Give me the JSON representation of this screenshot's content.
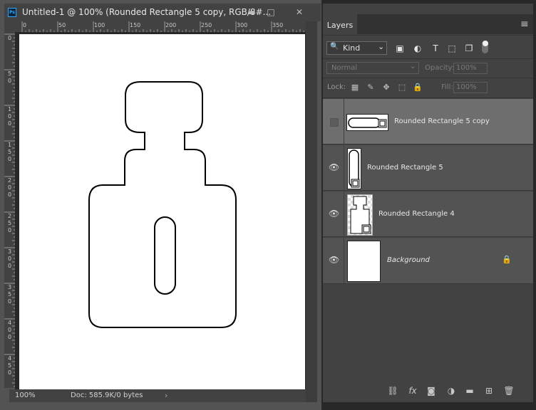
{
  "document": {
    "app_icon": "Ps",
    "title": "Untitled-1 @ 100% (Rounded Rectangle 5 copy, RGB/8#...",
    "window_buttons": {
      "minimize": "▬",
      "maximize": "□",
      "close": "✕"
    },
    "ruler_top_labels": [
      "0",
      "50",
      "100",
      "150",
      "200",
      "250",
      "300",
      "350"
    ],
    "ruler_left_labels": [
      "0",
      "5\n0",
      "1\n0\n0",
      "1\n5\n0",
      "2\n0\n0",
      "2\n5\n0",
      "3\n0\n0",
      "3\n5\n0",
      "4\n0\n0",
      "4\n5\n0"
    ],
    "status": {
      "zoom": "100%",
      "doc_info": "Doc: 585.9K/0 bytes",
      "arrow": "›"
    }
  },
  "layers_panel": {
    "collapse_icon": "◂◂",
    "close_icon": "✕",
    "tab_label": "Layers",
    "menu_icon": "≡",
    "filter": {
      "value": "Kind",
      "search_icon": "🔍",
      "chevron": "⌄"
    },
    "filter_icons": [
      "image-filter-icon",
      "adjustment-filter-icon",
      "type-filter-icon",
      "shape-filter-icon",
      "smart-object-filter-icon"
    ],
    "filter_glyphs": [
      "▣",
      "◐",
      "T",
      "⬚",
      "❐"
    ],
    "blend_mode": "Normal",
    "opacity_label": "Opacity:",
    "opacity_value": "100%",
    "lock_label": "Lock:",
    "lock_glyphs": [
      "▦",
      "✎",
      "✥",
      "⬚",
      "🔒"
    ],
    "fill_label": "Fill:",
    "fill_value": "100%",
    "layers": [
      {
        "name": "Rounded Rectangle 5 copy",
        "selected": true,
        "visible": false
      },
      {
        "name": "Rounded Rectangle 5",
        "selected": false,
        "visible": true
      },
      {
        "name": "Rounded Rectangle 4",
        "selected": false,
        "visible": true
      },
      {
        "name": "Background",
        "selected": false,
        "visible": true,
        "locked": true
      }
    ],
    "eye_glyph": "👁",
    "lock_glyph": "🔒",
    "footer_glyphs": [
      "⛓",
      "fx",
      "◙",
      "◑",
      "▬",
      "⊞",
      "🗑"
    ]
  }
}
